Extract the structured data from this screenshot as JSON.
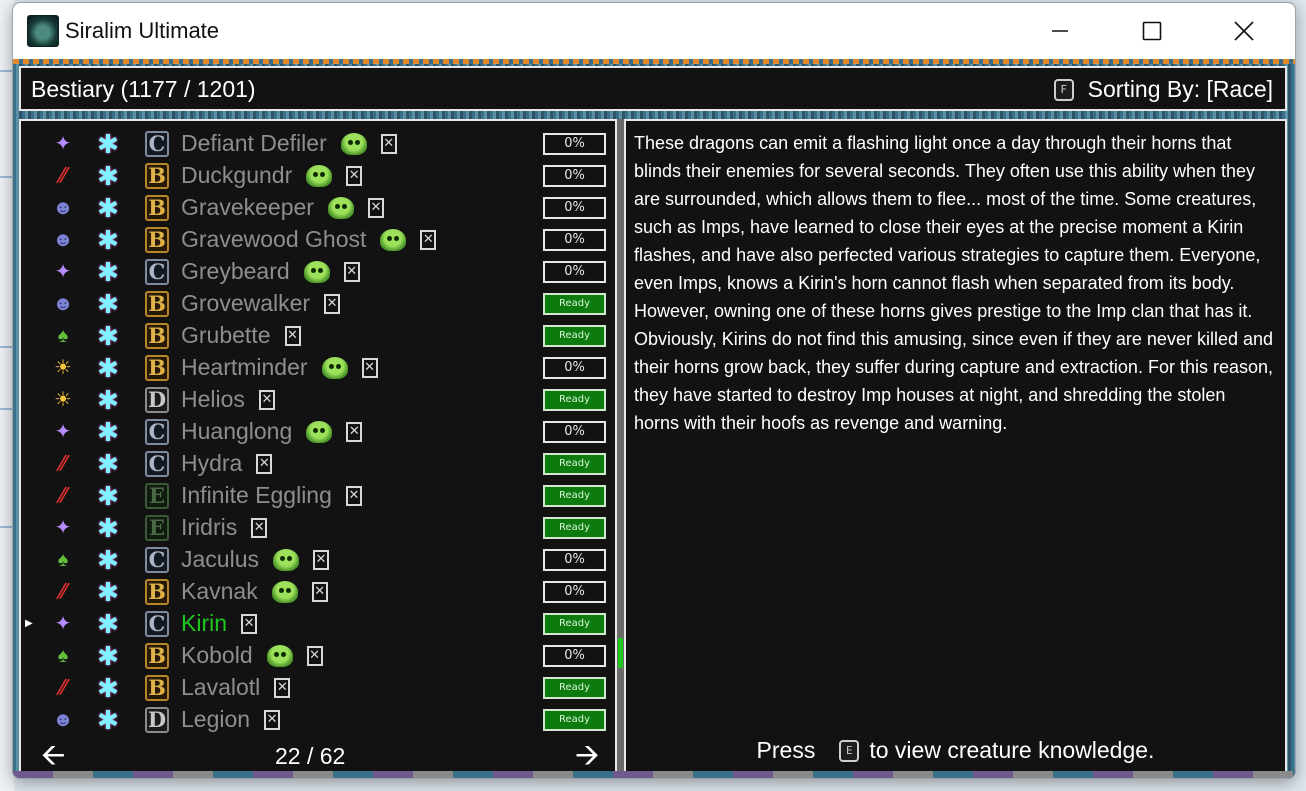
{
  "window": {
    "title": "Siralim Ultimate",
    "controls": [
      "minimize-icon",
      "maximize-icon",
      "close-icon"
    ]
  },
  "header": {
    "title": "Bestiary (1177 / 1201)",
    "sort_key": "F",
    "sort_label": "Sorting By: [Race]"
  },
  "creatures": [
    {
      "race": "sparkle",
      "rank": "C",
      "name": "Defiant Defiler",
      "goblin": true,
      "status": "0%",
      "ready": false
    },
    {
      "race": "claw",
      "rank": "B",
      "name": "Duckgundr",
      "goblin": true,
      "status": "0%",
      "ready": false
    },
    {
      "race": "skull",
      "rank": "B",
      "name": "Gravekeeper",
      "goblin": true,
      "status": "0%",
      "ready": false
    },
    {
      "race": "skull",
      "rank": "B",
      "name": "Gravewood Ghost",
      "goblin": true,
      "status": "0%",
      "ready": false
    },
    {
      "race": "sparkle",
      "rank": "C",
      "name": "Greybeard",
      "goblin": true,
      "status": "0%",
      "ready": false
    },
    {
      "race": "skull",
      "rank": "B",
      "name": "Grovewalker",
      "goblin": false,
      "status": "Ready",
      "ready": true
    },
    {
      "race": "leaf",
      "rank": "B",
      "name": "Grubette",
      "goblin": false,
      "status": "Ready",
      "ready": true
    },
    {
      "race": "sun",
      "rank": "B",
      "name": "Heartminder",
      "goblin": true,
      "status": "0%",
      "ready": false
    },
    {
      "race": "sun",
      "rank": "D",
      "name": "Helios",
      "goblin": false,
      "status": "Ready",
      "ready": true
    },
    {
      "race": "sparkle",
      "rank": "C",
      "name": "Huanglong",
      "goblin": true,
      "status": "0%",
      "ready": false
    },
    {
      "race": "claw",
      "rank": "C",
      "name": "Hydra",
      "goblin": false,
      "status": "Ready",
      "ready": true
    },
    {
      "race": "claw",
      "rank": "E",
      "name": "Infinite Eggling",
      "goblin": false,
      "status": "Ready",
      "ready": true
    },
    {
      "race": "sparkle",
      "rank": "E",
      "name": "Iridris",
      "goblin": false,
      "status": "Ready",
      "ready": true
    },
    {
      "race": "leaf",
      "rank": "C",
      "name": "Jaculus",
      "goblin": true,
      "status": "0%",
      "ready": false
    },
    {
      "race": "claw",
      "rank": "B",
      "name": "Kavnak",
      "goblin": true,
      "status": "0%",
      "ready": false
    },
    {
      "race": "sparkle",
      "rank": "C",
      "name": "Kirin",
      "goblin": false,
      "status": "Ready",
      "ready": true,
      "selected": true
    },
    {
      "race": "leaf",
      "rank": "B",
      "name": "Kobold",
      "goblin": true,
      "status": "0%",
      "ready": false
    },
    {
      "race": "claw",
      "rank": "B",
      "name": "Lavalotl",
      "goblin": false,
      "status": "Ready",
      "ready": true
    },
    {
      "race": "skull",
      "rank": "D",
      "name": "Legion",
      "goblin": false,
      "status": "Ready",
      "ready": true
    }
  ],
  "pager": {
    "label": "22 / 62"
  },
  "description": "These dragons can emit a flashing light once a day through their horns that blinds their enemies for several seconds. They often use this ability when they are surrounded, which allows them to flee... most of the time. Some creatures, such as Imps, have learned to close their eyes at the precise moment a Kirin flashes, and have also perfected various strategies to capture them. Everyone, even Imps, knows a Kirin's horn cannot flash when separated from its body. However, owning one of these horns gives prestige to the Imp clan that has it. Obviously, Kirins do not find this amusing, since even if they are never killed and their horns grow back, they suffer during capture and extraction. For this reason, they have started to destroy Imp houses at night, and shredding the stolen horns with their hoofs as revenge and warning.",
  "prompt": {
    "before": "Press",
    "key": "E",
    "after": "to view creature knowledge."
  },
  "colors": {
    "selected": "#1ec81e",
    "ready_bg": "#0d7a0d",
    "name_default": "#8e8e8e"
  }
}
